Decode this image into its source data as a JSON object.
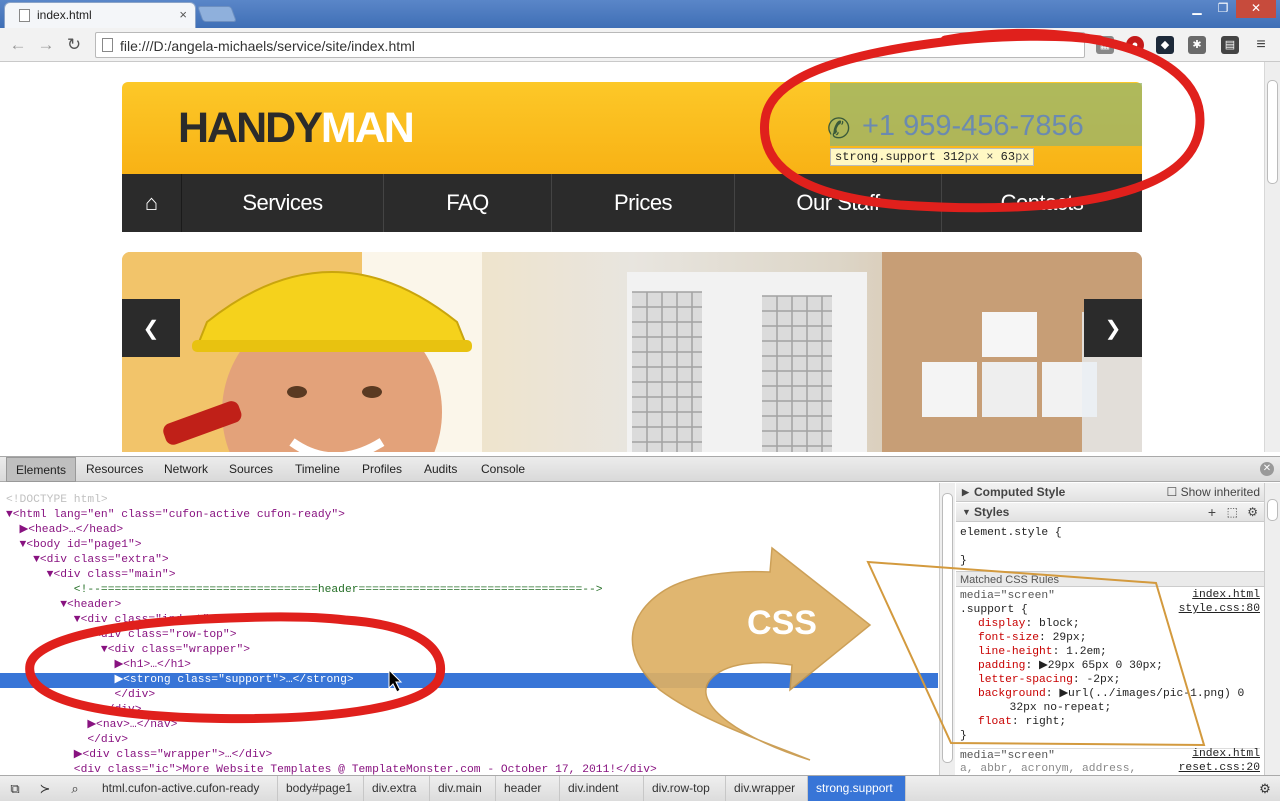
{
  "browser": {
    "tab_title": "index.html",
    "tab_close": "×",
    "url": "file:///D:/angela-michaels/service/site/index.html",
    "window_buttons": [
      "▁",
      "❐",
      "✕"
    ]
  },
  "site": {
    "logo_part1": "HANDY",
    "logo_part2": "MAN",
    "phone": "+1 959-456-7856",
    "tooltip_selector": "strong.support",
    "tooltip_w": "312",
    "tooltip_unit1": "px",
    "tooltip_x": "×",
    "tooltip_h": "63",
    "tooltip_unit2": "px",
    "nav": [
      "Services",
      "FAQ",
      "Prices",
      "Our Staff",
      "Contacts"
    ],
    "prev_glyph": "❮",
    "next_glyph": "❯"
  },
  "devtools": {
    "tabs": [
      "Elements",
      "Resources",
      "Network",
      "Sources",
      "Timeline",
      "Profiles",
      "Audits",
      "Console"
    ],
    "active_tab": "Elements",
    "dom_lines": [
      {
        "text": "<!DOCTYPE html>",
        "cls": "dt"
      },
      {
        "text": "▼<html lang=\"en\" class=\"cufon-active cufon-ready\">"
      },
      {
        "text": "  ▶<head>…</head>"
      },
      {
        "text": "  ▼<body id=\"page1\">"
      },
      {
        "text": "    ▼<div class=\"extra\">"
      },
      {
        "text": "      ▼<div class=\"main\">"
      },
      {
        "text": "          <!--================================header=================================-->",
        "cls": "cm"
      },
      {
        "text": "        ▼<header>"
      },
      {
        "text": "          ▼<div class=\"indent\">"
      },
      {
        "text": "            ▼<div class=\"row-top\">"
      },
      {
        "text": "              ▼<div class=\"wrapper\">"
      },
      {
        "text": "                ▶<h1>…</h1>"
      },
      {
        "text": "                ▶<strong class=\"support\">…</strong>",
        "cls": "sel"
      },
      {
        "text": "                </div>"
      },
      {
        "text": "              </div>"
      },
      {
        "text": "            ▶<nav>…</nav>"
      },
      {
        "text": "            </div>"
      },
      {
        "text": "          ▶<div class=\"wrapper\">…</div>"
      },
      {
        "text": "          <div class=\"ic\">More Website Templates @ TemplateMonster.com - October 17, 2011!</div>"
      }
    ],
    "computed_style_label": "Computed Style",
    "show_inherited_label": "Show inherited",
    "styles_label": "Styles",
    "element_style": "element.style {",
    "close_brace": "}",
    "matched_label": "Matched CSS Rules",
    "media1": "media=\"screen\"",
    "src1": "index.html",
    "selector": ".support {",
    "src2": "style.css:80",
    "props": [
      {
        "name": "display",
        "value": "block;"
      },
      {
        "name": "font-size",
        "value": "29px;"
      },
      {
        "name": "line-height",
        "value": "1.2em;"
      },
      {
        "name": "padding",
        "value": "▶29px 65px 0 30px;"
      },
      {
        "name": "letter-spacing",
        "value": "-2px;"
      },
      {
        "name": "background",
        "value": "▶url(../images/pic-1.png) 0"
      },
      {
        "name": "",
        "value": "  32px no-repeat;"
      },
      {
        "name": "float",
        "value": "right;"
      }
    ],
    "media2": "media=\"screen\"",
    "src3": "index.html",
    "trail": "a, abbr, acronym, address,",
    "src4": "reset.css:20",
    "breadcrumbs": [
      "html.cufon-active.cufon-ready",
      "body#page1",
      "div.extra",
      "div.main",
      "header",
      "div.indent",
      "div.row-top",
      "div.wrapper",
      "strong.support"
    ],
    "selected_crumb": "strong.support"
  },
  "annotation": {
    "label": "CSS",
    "ellipse_color": "#e0201c",
    "arrow_color": "#deb064"
  }
}
